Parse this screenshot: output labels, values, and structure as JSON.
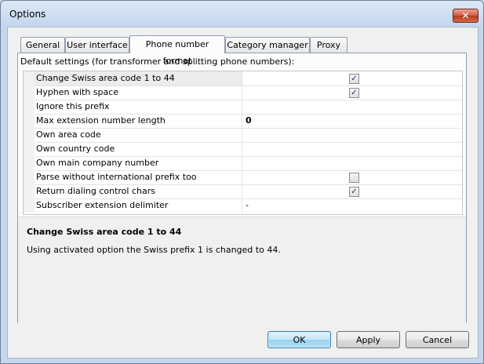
{
  "window": {
    "title": "Options",
    "close_glyph": "✕"
  },
  "tabs": [
    {
      "label": "General",
      "active": false
    },
    {
      "label": "User interface",
      "active": false
    },
    {
      "label": "Phone number format",
      "active": true
    },
    {
      "label": "Category manager",
      "active": false
    },
    {
      "label": "Proxy",
      "active": false
    }
  ],
  "panel": {
    "section_label": "Default settings (for transformer and splitting phone numbers):",
    "properties": [
      {
        "name": "Change Swiss area code 1 to 44",
        "type": "checkbox",
        "checked": true,
        "value": ""
      },
      {
        "name": "Hyphen with space",
        "type": "checkbox",
        "checked": true,
        "value": ""
      },
      {
        "name": "Ignore this prefix",
        "type": "text",
        "value": ""
      },
      {
        "name": "Max extension number length",
        "type": "text",
        "value": "0"
      },
      {
        "name": "Own area code",
        "type": "text",
        "value": ""
      },
      {
        "name": "Own country code",
        "type": "text",
        "value": ""
      },
      {
        "name": "Own main company number",
        "type": "text",
        "value": ""
      },
      {
        "name": "Parse without international prefix too",
        "type": "checkbox",
        "checked": false,
        "value": ""
      },
      {
        "name": "Return dialing control chars",
        "type": "checkbox",
        "checked": true,
        "value": ""
      },
      {
        "name": "Subscriber extension delimiter",
        "type": "text",
        "value": "-"
      }
    ],
    "selected_index": 0,
    "description": {
      "title": "Change Swiss area code 1 to 44",
      "text": "Using activated option the Swiss prefix 1 is changed to 44."
    }
  },
  "buttons": {
    "ok": "OK",
    "apply": "Apply",
    "cancel": "Cancel"
  }
}
